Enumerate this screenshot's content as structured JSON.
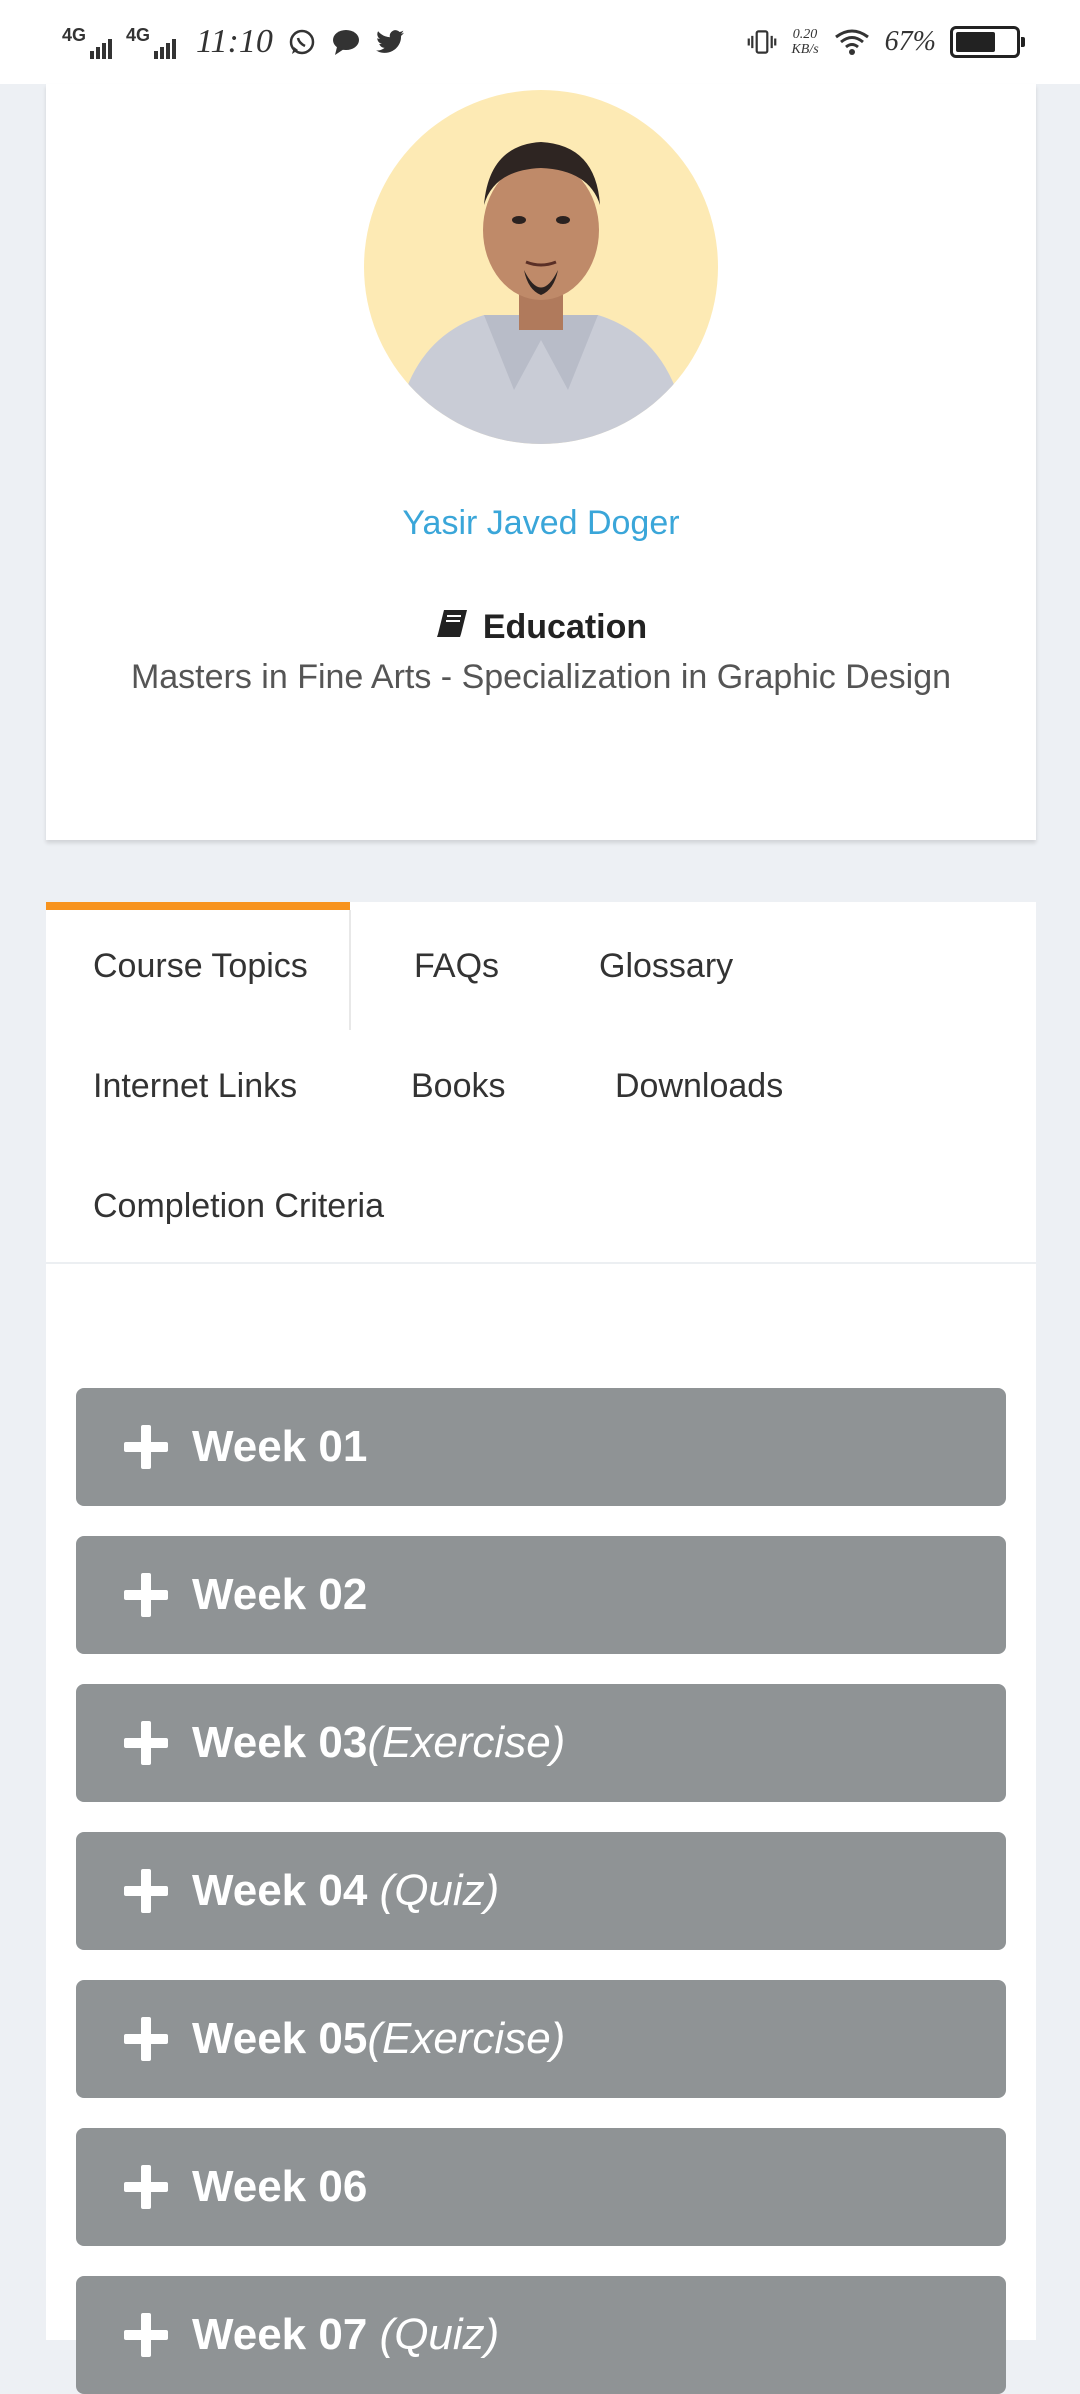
{
  "status_bar": {
    "network1": "4G",
    "network2": "4G",
    "time": "11:10",
    "speed_value": "0.20",
    "speed_unit": "KB/s",
    "battery_percent": "67%",
    "battery_level": 0.67
  },
  "profile": {
    "name": "Yasir Javed Doger",
    "education_heading": "Education",
    "education_text": "Masters in Fine Arts - Specialization in Graphic Design"
  },
  "tabs": {
    "course_topics": "Course Topics",
    "faqs": "FAQs",
    "glossary": "Glossary",
    "internet_links": "Internet Links",
    "books": "Books",
    "downloads": "Downloads",
    "completion_criteria": "Completion Criteria",
    "active": "Course Topics"
  },
  "weeks": [
    {
      "title": "Week 01",
      "sub": ""
    },
    {
      "title": "Week 02",
      "sub": ""
    },
    {
      "title": "Week 03",
      "sub": "(Exercise)"
    },
    {
      "title": "Week 04 ",
      "sub": "(Quiz)"
    },
    {
      "title": "Week 05",
      "sub": "(Exercise)"
    },
    {
      "title": "Week 06",
      "sub": ""
    },
    {
      "title": "Week 07 ",
      "sub": "(Quiz)"
    }
  ],
  "colors": {
    "accent_orange": "#f7931e",
    "name_blue": "#3aa6d9",
    "week_gray": "#8f9395",
    "page_bg": "#edf0f4"
  },
  "icons": [
    "whatsapp-icon",
    "message-icon",
    "twitter-icon",
    "vibrate-icon",
    "wifi-icon",
    "battery-icon",
    "book-icon",
    "plus-icon"
  ]
}
